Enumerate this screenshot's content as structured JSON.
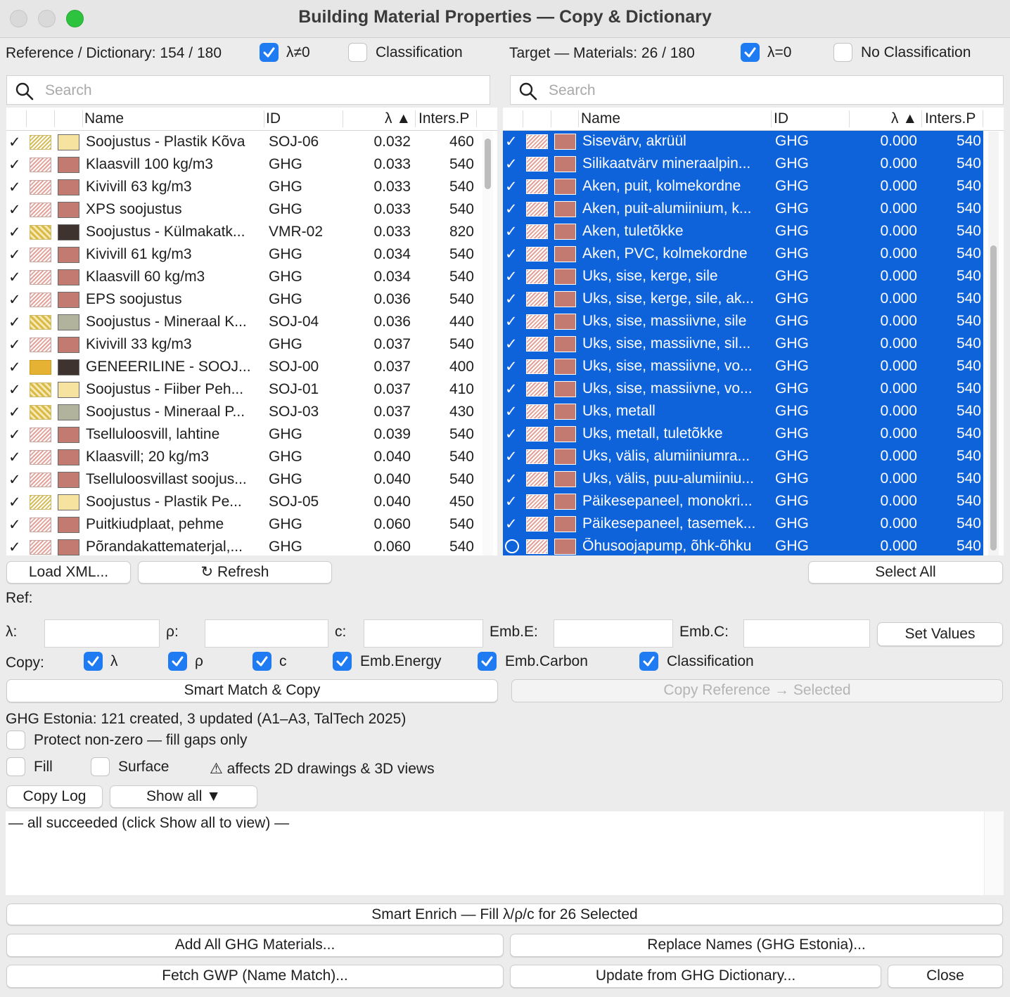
{
  "window": {
    "title": "Building Material Properties — Copy & Dictionary"
  },
  "reference": {
    "header": "Reference / Dictionary: 154 / 180",
    "filter_lambda_nonzero": {
      "label": "λ≠0",
      "checked": true
    },
    "filter_classification": {
      "label": "Classification",
      "checked": false
    },
    "search_placeholder": "Search",
    "columns": {
      "name": "Name",
      "id": "ID",
      "lambda": "λ ▲",
      "inters": "Inters.P"
    },
    "rows": [
      {
        "check": "✓",
        "hatch": "yellow",
        "swatch": "#f7e3a0",
        "name": "Soojustus - Plastik Kõva",
        "id": "SOJ-06",
        "lambda": "0.032",
        "inters": "460"
      },
      {
        "check": "✓",
        "hatch": "red",
        "swatch": "#c37a70",
        "name": "Klaasvill 100 kg/m3",
        "id": "GHG",
        "lambda": "0.033",
        "inters": "540"
      },
      {
        "check": "✓",
        "hatch": "red",
        "swatch": "#c37a70",
        "name": "Kivivill  63 kg/m3",
        "id": "GHG",
        "lambda": "0.033",
        "inters": "540"
      },
      {
        "check": "✓",
        "hatch": "red",
        "swatch": "#c37a70",
        "name": "XPS soojustus",
        "id": "GHG",
        "lambda": "0.033",
        "inters": "540"
      },
      {
        "check": "✓",
        "hatch": "gold",
        "swatch": "#3f3330",
        "name": "Soojustus - Külmakatk...",
        "id": "VMR-02",
        "lambda": "0.033",
        "inters": "820"
      },
      {
        "check": "✓",
        "hatch": "red",
        "swatch": "#c37a70",
        "name": "Kivivill  61 kg/m3",
        "id": "GHG",
        "lambda": "0.034",
        "inters": "540"
      },
      {
        "check": "✓",
        "hatch": "red",
        "swatch": "#c37a70",
        "name": "Klaasvill 60 kg/m3",
        "id": "GHG",
        "lambda": "0.034",
        "inters": "540"
      },
      {
        "check": "✓",
        "hatch": "red",
        "swatch": "#c37a70",
        "name": "EPS soojustus",
        "id": "GHG",
        "lambda": "0.036",
        "inters": "540"
      },
      {
        "check": "✓",
        "hatch": "gold",
        "swatch": "#b2b39c",
        "name": "Soojustus - Mineraal K...",
        "id": "SOJ-04",
        "lambda": "0.036",
        "inters": "440"
      },
      {
        "check": "✓",
        "hatch": "red",
        "swatch": "#c37a70",
        "name": "Kivivill 33 kg/m3",
        "id": "GHG",
        "lambda": "0.037",
        "inters": "540"
      },
      {
        "check": "✓",
        "hatch": "solid",
        "swatch": "#3f3330",
        "name": "GENEERILINE - SOOJ...",
        "id": "SOJ-00",
        "lambda": "0.037",
        "inters": "400"
      },
      {
        "check": "✓",
        "hatch": "gold",
        "swatch": "#f7e3a0",
        "name": "Soojustus - Fiiber Peh...",
        "id": "SOJ-01",
        "lambda": "0.037",
        "inters": "410"
      },
      {
        "check": "✓",
        "hatch": "gold",
        "swatch": "#b2b39c",
        "name": "Soojustus - Mineraal P...",
        "id": "SOJ-03",
        "lambda": "0.037",
        "inters": "430"
      },
      {
        "check": "✓",
        "hatch": "red",
        "swatch": "#c37a70",
        "name": "Tselluloosvill, lahtine",
        "id": "GHG",
        "lambda": "0.039",
        "inters": "540"
      },
      {
        "check": "✓",
        "hatch": "red",
        "swatch": "#c37a70",
        "name": "Klaasvill; 20 kg/m3",
        "id": "GHG",
        "lambda": "0.040",
        "inters": "540"
      },
      {
        "check": "✓",
        "hatch": "red",
        "swatch": "#c37a70",
        "name": "Tselluloosvillast soojus...",
        "id": "GHG",
        "lambda": "0.040",
        "inters": "540"
      },
      {
        "check": "✓",
        "hatch": "yellow",
        "swatch": "#f7e3a0",
        "name": "Soojustus - Plastik Pe...",
        "id": "SOJ-05",
        "lambda": "0.040",
        "inters": "450"
      },
      {
        "check": "✓",
        "hatch": "red",
        "swatch": "#c37a70",
        "name": "Puitkiudplaat, pehme",
        "id": "GHG",
        "lambda": "0.060",
        "inters": "540"
      },
      {
        "check": "✓",
        "hatch": "red",
        "swatch": "#c37a70",
        "name": "Põrandakattematerjal,...",
        "id": "GHG",
        "lambda": "0.060",
        "inters": "540"
      }
    ]
  },
  "target": {
    "header": "Target — Materials: 26 / 180",
    "filter_lambda_zero": {
      "label": "λ=0",
      "checked": true
    },
    "filter_no_classification": {
      "label": "No Classification",
      "checked": false
    },
    "search_placeholder": "Search",
    "columns": {
      "name": "Name",
      "id": "ID",
      "lambda": "λ ▲",
      "inters": "Inters.P"
    },
    "rows": [
      {
        "check": "✓",
        "name": "Sisevärv, akrüül",
        "id": "GHG",
        "lambda": "0.000",
        "inters": "540"
      },
      {
        "check": "✓",
        "name": "Silikaatvärv mineraalpin...",
        "id": "GHG",
        "lambda": "0.000",
        "inters": "540"
      },
      {
        "check": "✓",
        "name": "Aken, puit, kolmekordne",
        "id": "GHG",
        "lambda": "0.000",
        "inters": "540"
      },
      {
        "check": "✓",
        "name": "Aken, puit-alumiinium, k...",
        "id": "GHG",
        "lambda": "0.000",
        "inters": "540"
      },
      {
        "check": "✓",
        "name": "Aken, tuletõkke",
        "id": "GHG",
        "lambda": "0.000",
        "inters": "540"
      },
      {
        "check": "✓",
        "name": "Aken, PVC, kolmekordne",
        "id": "GHG",
        "lambda": "0.000",
        "inters": "540"
      },
      {
        "check": "✓",
        "name": "Uks, sise, kerge, sile",
        "id": "GHG",
        "lambda": "0.000",
        "inters": "540"
      },
      {
        "check": "✓",
        "name": "Uks, sise, kerge, sile, ak...",
        "id": "GHG",
        "lambda": "0.000",
        "inters": "540"
      },
      {
        "check": "✓",
        "name": "Uks, sise, massiivne, sile",
        "id": "GHG",
        "lambda": "0.000",
        "inters": "540"
      },
      {
        "check": "✓",
        "name": "Uks, sise, massiivne, sil...",
        "id": "GHG",
        "lambda": "0.000",
        "inters": "540"
      },
      {
        "check": "✓",
        "name": "Uks, sise, massiivne, vo...",
        "id": "GHG",
        "lambda": "0.000",
        "inters": "540"
      },
      {
        "check": "✓",
        "name": "Uks, sise, massiivne, vo...",
        "id": "GHG",
        "lambda": "0.000",
        "inters": "540"
      },
      {
        "check": "✓",
        "name": "Uks, metall",
        "id": "GHG",
        "lambda": "0.000",
        "inters": "540"
      },
      {
        "check": "✓",
        "name": "Uks, metall, tuletõkke",
        "id": "GHG",
        "lambda": "0.000",
        "inters": "540"
      },
      {
        "check": "✓",
        "name": "Uks, välis, alumiiniumra...",
        "id": "GHG",
        "lambda": "0.000",
        "inters": "540"
      },
      {
        "check": "✓",
        "name": "Uks, välis, puu-alumiiniu...",
        "id": "GHG",
        "lambda": "0.000",
        "inters": "540"
      },
      {
        "check": "✓",
        "name": "Päikesepaneel, monokri...",
        "id": "GHG",
        "lambda": "0.000",
        "inters": "540"
      },
      {
        "check": "✓",
        "name": "Päikesepaneel, tasemek...",
        "id": "GHG",
        "lambda": "0.000",
        "inters": "540"
      },
      {
        "check": "O",
        "name": "Õhusoojapump, õhk-õhku",
        "id": "GHG",
        "lambda": "0.000",
        "inters": "540"
      }
    ]
  },
  "buttons": {
    "load_xml": "Load XML...",
    "refresh": "↻ Refresh",
    "select_all": "Select All",
    "set_values": "Set Values",
    "smart_match_copy": "Smart Match & Copy",
    "copy_reference": "Copy Reference → Selected",
    "copy_log": "Copy Log",
    "show_all": "Show all ▼",
    "smart_enrich": "Smart Enrich — Fill λ/ρ/c for 26 Selected",
    "add_all_ghg": "Add All GHG Materials...",
    "replace_names": "Replace Names (GHG Estonia)...",
    "fetch_gwp": "Fetch GWP (Name Match)...",
    "update_ghg": "Update from GHG Dictionary...",
    "close": "Close"
  },
  "ref_label": "Ref:",
  "values": {
    "lambda_label": "λ:",
    "rho_label": "ρ:",
    "c_label": "c:",
    "emb_e_label": "Emb.E:",
    "emb_c_label": "Emb.C:",
    "lambda": "",
    "rho": "",
    "c": "",
    "emb_e": "",
    "emb_c": ""
  },
  "copy": {
    "label": "Copy:",
    "lambda": {
      "label": "λ",
      "checked": true
    },
    "rho": {
      "label": "ρ",
      "checked": true
    },
    "c": {
      "label": "c",
      "checked": true
    },
    "emb_energy": {
      "label": "Emb.Energy",
      "checked": true
    },
    "emb_carbon": {
      "label": "Emb.Carbon",
      "checked": true
    },
    "classification": {
      "label": "Classification",
      "checked": true
    }
  },
  "status": "GHG Estonia: 121 created, 3 updated  (A1–A3, TalTech 2025)",
  "protect": {
    "label": "Protect non-zero — fill gaps only",
    "checked": false
  },
  "fill": {
    "label": "Fill",
    "checked": false
  },
  "surface": {
    "label": "Surface",
    "checked": false
  },
  "warning": "⚠ affects 2D drawings & 3D views",
  "log_text": "— all succeeded (click Show all to view) —",
  "colors": {
    "selection": "#0f63da",
    "accent": "#1e7bf2"
  }
}
